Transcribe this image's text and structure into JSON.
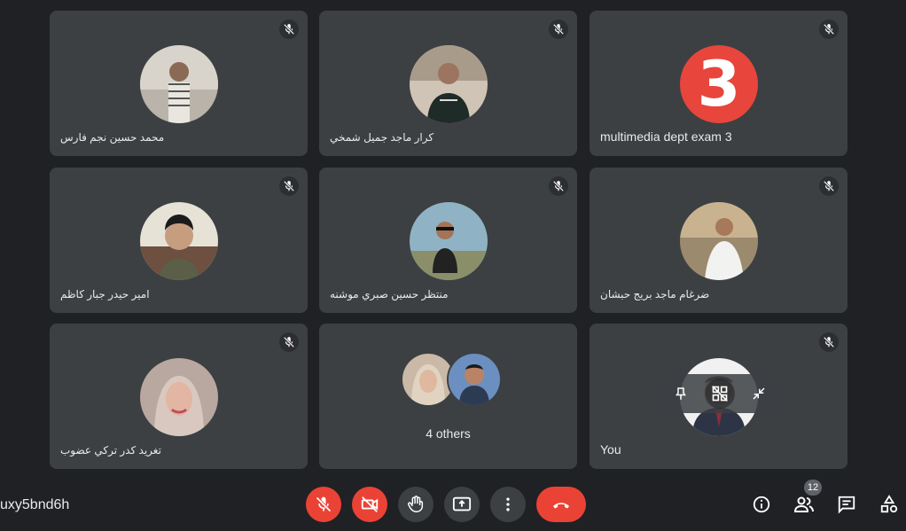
{
  "participants": [
    {
      "name": "محمد حسين نجم فارس"
    },
    {
      "name": "كرار ماجد جميل شمخي"
    },
    {
      "name": "multimedia dept exam 3",
      "avatar_text": "3"
    },
    {
      "name": "امير حيدر جبار كاظم"
    },
    {
      "name": "منتظر حسين صبري موشنه"
    },
    {
      "name": "ضرغام ماجد بريج حبشان"
    },
    {
      "name": "تغريد كدر تركي عضوب"
    },
    {
      "name": "4 others"
    },
    {
      "name": "You"
    }
  ],
  "meeting": {
    "code": "uxy5bnd6h"
  },
  "controls": {
    "mic": "mic-off-icon",
    "camera": "camera-off-icon",
    "raise_hand": "hand-icon",
    "present": "present-icon",
    "more": "more-vert-icon",
    "leave": "end-call-icon"
  },
  "right": {
    "people_count": "12"
  },
  "colors": {
    "background": "#202124",
    "tile": "#3c4043",
    "danger": "#ea4335",
    "avatar3": "#e8453c"
  }
}
